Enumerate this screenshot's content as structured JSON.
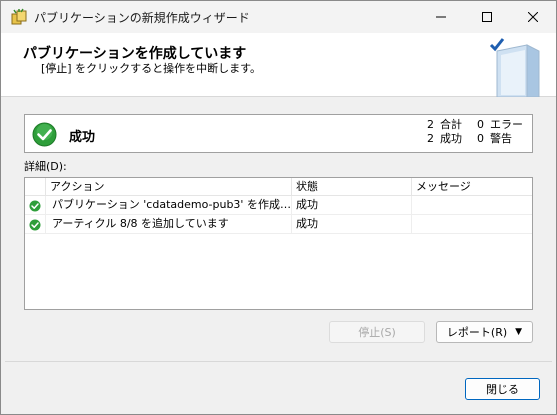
{
  "window": {
    "title": "パブリケーションの新規作成ウィザード"
  },
  "banner": {
    "title": "パブリケーションを作成しています",
    "subtitle": "[停止] をクリックすると操作を中断します。"
  },
  "status": {
    "label": "成功",
    "counts": [
      {
        "count": "2",
        "label": "合計",
        "count2": "0",
        "label2": "エラー"
      },
      {
        "count": "2",
        "label": "成功",
        "count2": "0",
        "label2": "警告"
      }
    ]
  },
  "details": {
    "label": "詳細(D):",
    "columns": [
      "アクション",
      "状態",
      "メッセージ"
    ],
    "rows": [
      {
        "action": "パブリケーション 'cdatademo-pub3' を作成して...",
        "status": "成功",
        "message": ""
      },
      {
        "action": "アーティクル 8/8 を追加しています",
        "status": "成功",
        "message": ""
      }
    ]
  },
  "buttons": {
    "stop": "停止(S)",
    "report": "レポート(R)",
    "close": "閉じる"
  },
  "colors": {
    "success_green": "#2e9e3a",
    "accent_blue": "#0067c0"
  }
}
